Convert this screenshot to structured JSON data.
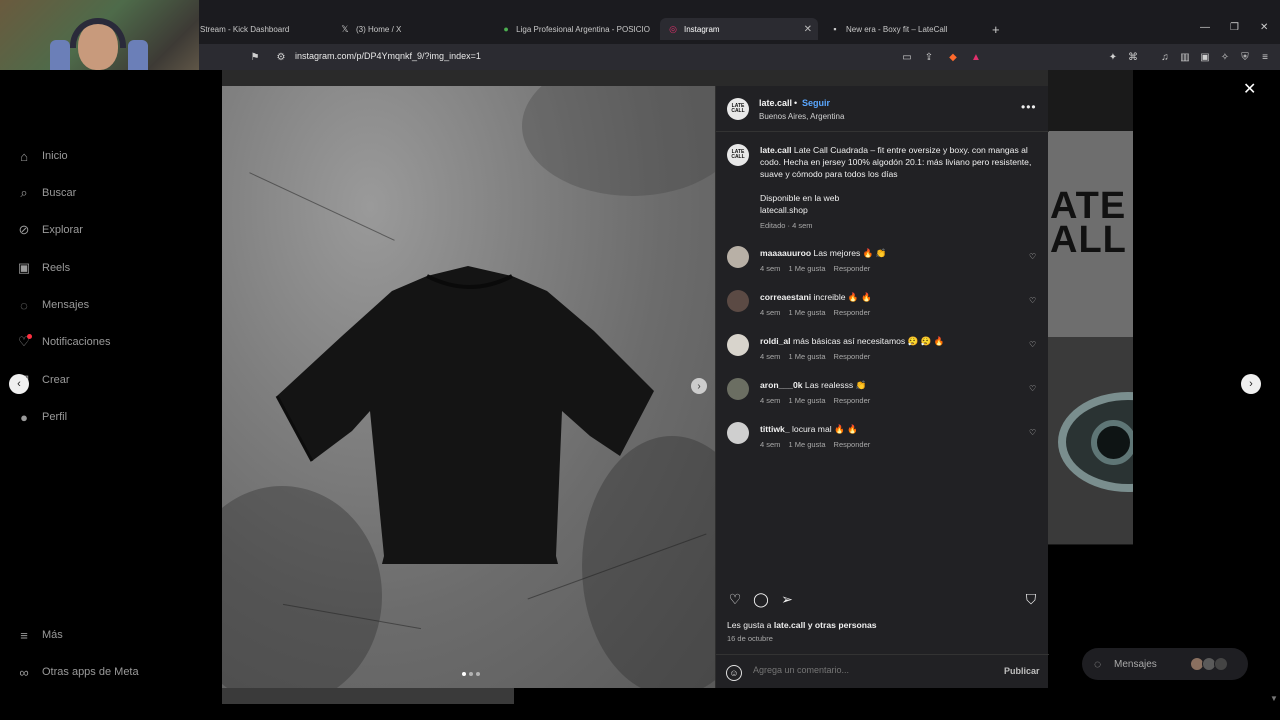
{
  "browser": {
    "tabs": [
      {
        "label": "Stream - Kick Dashboard",
        "icon": "kick-icon"
      },
      {
        "label": "(3) Home / X",
        "icon": "x-icon"
      },
      {
        "label": "Liga Profesional Argentina - POSICIO",
        "icon": "soccer-icon"
      },
      {
        "label": "Instagram",
        "icon": "instagram-icon",
        "active": true
      },
      {
        "label": "New era - Boxy fit – LateCall",
        "icon": "page-icon"
      }
    ],
    "url": "instagram.com/p/DP4Ymqnkf_9/?img_index=1"
  },
  "sidebar": {
    "items": [
      {
        "label": "Inicio",
        "icon": "home-icon"
      },
      {
        "label": "Buscar",
        "icon": "search-icon"
      },
      {
        "label": "Explorar",
        "icon": "compass-icon"
      },
      {
        "label": "Reels",
        "icon": "reels-icon"
      },
      {
        "label": "Mensajes",
        "icon": "messenger-icon"
      },
      {
        "label": "Notificaciones",
        "icon": "heart-icon"
      },
      {
        "label": "Crear",
        "icon": "plus-icon"
      },
      {
        "label": "Perfil",
        "icon": "profile-icon"
      }
    ],
    "bottom": [
      {
        "label": "Más",
        "icon": "menu-icon"
      },
      {
        "label": "Otras apps de Meta",
        "icon": "meta-icon"
      }
    ]
  },
  "post": {
    "avatar_text": "LATE CALL",
    "username": "late.call",
    "separator": "•",
    "follow_label": "Seguir",
    "location": "Buenos Aires, Argentina",
    "caption_user": "late.call",
    "caption_text": "Late Call Cuadrada – fit entre oversize y boxy. con mangas al codo. Hecha en jersey 100% algodón 20.1: más liviano pero resistente, suave y cómodo para todos los días",
    "caption_extra_1": "Disponible en la web",
    "caption_extra_2": "latecall.shop",
    "caption_meta": "Editado · 4 sem",
    "comments": [
      {
        "user": "maaaauuroo",
        "text": "Las mejores 🔥 👏",
        "time": "4 sem",
        "likes": "1 Me gusta",
        "reply": "Responder"
      },
      {
        "user": "correaestani",
        "text": "increible 🔥 🔥",
        "time": "4 sem",
        "likes": "1 Me gusta",
        "reply": "Responder"
      },
      {
        "user": "roldi_al",
        "text": "más básicas así necesitamos 😮‍💨 😮‍💨 🔥",
        "time": "4 sem",
        "likes": "1 Me gusta",
        "reply": "Responder"
      },
      {
        "user": "aron___0k",
        "text": "Las realesss 👏",
        "time": "4 sem",
        "likes": "1 Me gusta",
        "reply": "Responder"
      },
      {
        "user": "tittiwk_",
        "text": "locura mal 🔥 🔥",
        "time": "4 sem",
        "likes": "1 Me gusta",
        "reply": "Responder"
      }
    ],
    "likes_prefix": "Les gusta a",
    "likes_user": "late.call",
    "likes_suffix": "y otras personas",
    "date": "16 de octubre",
    "comment_placeholder": "Agrega un comentario...",
    "publish_label": "Publicar",
    "carousel_index": 1,
    "carousel_count": 3
  },
  "background_tile_text": "ATE\nALL",
  "messages_pill": {
    "label": "Mensajes"
  },
  "colors": {
    "accent": "#5aa7ff",
    "notification": "#ff3040",
    "panel": "#212124"
  }
}
